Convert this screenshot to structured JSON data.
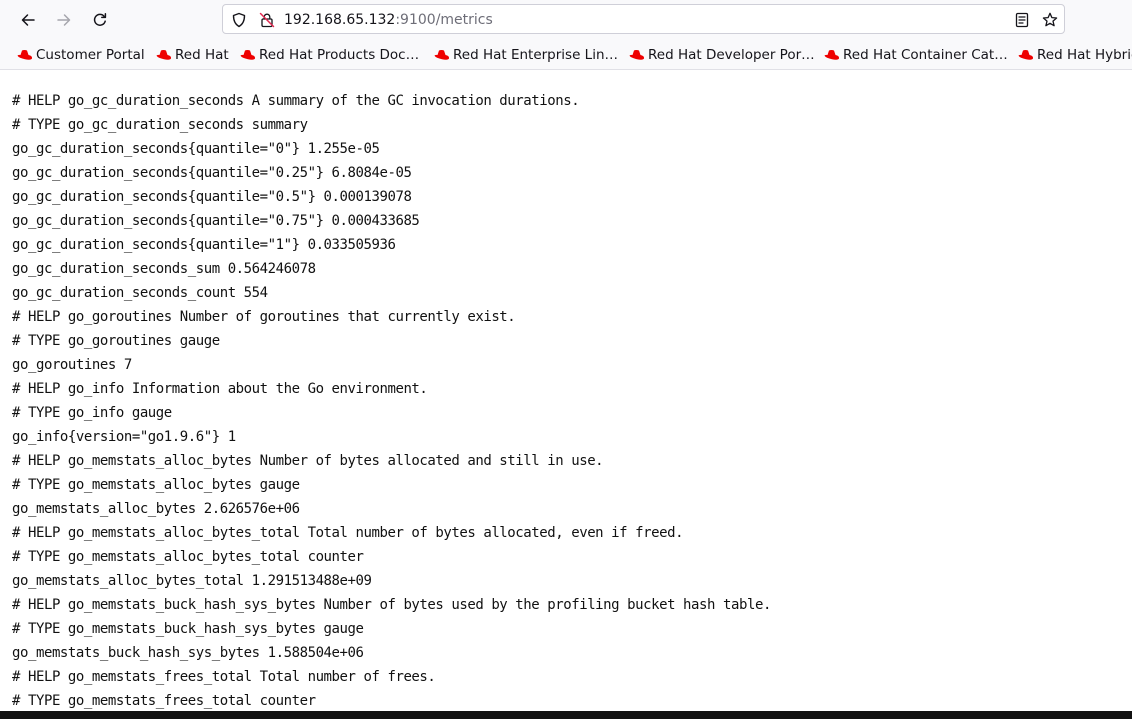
{
  "toolbar": {
    "back_icon": "arrow-left-icon",
    "forward_icon": "arrow-right-icon",
    "reload_icon": "reload-icon",
    "url": {
      "host": "192.168.65.132",
      "rest": ":9100/metrics"
    },
    "icons": [
      "shield-icon",
      "insecure-lock-icon",
      "reader-view-icon",
      "bookmark-star-icon"
    ]
  },
  "bookmarks": [
    {
      "label": "Customer Portal",
      "icon": "red-hat-icon"
    },
    {
      "label": "Red Hat",
      "icon": "red-hat-icon"
    },
    {
      "label": "Red Hat Products Doc…",
      "icon": "red-hat-icon"
    },
    {
      "label": "Red Hat Enterprise Lin…",
      "icon": "red-hat-icon"
    },
    {
      "label": "Red Hat Developer Por…",
      "icon": "red-hat-icon"
    },
    {
      "label": "Red Hat Container Cat…",
      "icon": "red-hat-icon"
    },
    {
      "label": "Red Hat Hybrid",
      "icon": "red-hat-icon"
    }
  ],
  "colors": {
    "red_hat": "#ee0000",
    "toolbar_bg": "#f9f9fb",
    "text": "#111111"
  },
  "metrics": [
    "# HELP go_gc_duration_seconds A summary of the GC invocation durations.",
    "# TYPE go_gc_duration_seconds summary",
    "go_gc_duration_seconds{quantile=\"0\"} 1.255e-05",
    "go_gc_duration_seconds{quantile=\"0.25\"} 6.8084e-05",
    "go_gc_duration_seconds{quantile=\"0.5\"} 0.000139078",
    "go_gc_duration_seconds{quantile=\"0.75\"} 0.000433685",
    "go_gc_duration_seconds{quantile=\"1\"} 0.033505936",
    "go_gc_duration_seconds_sum 0.564246078",
    "go_gc_duration_seconds_count 554",
    "# HELP go_goroutines Number of goroutines that currently exist.",
    "# TYPE go_goroutines gauge",
    "go_goroutines 7",
    "# HELP go_info Information about the Go environment.",
    "# TYPE go_info gauge",
    "go_info{version=\"go1.9.6\"} 1",
    "# HELP go_memstats_alloc_bytes Number of bytes allocated and still in use.",
    "# TYPE go_memstats_alloc_bytes gauge",
    "go_memstats_alloc_bytes 2.626576e+06",
    "# HELP go_memstats_alloc_bytes_total Total number of bytes allocated, even if freed.",
    "# TYPE go_memstats_alloc_bytes_total counter",
    "go_memstats_alloc_bytes_total 1.291513488e+09",
    "# HELP go_memstats_buck_hash_sys_bytes Number of bytes used by the profiling bucket hash table.",
    "# TYPE go_memstats_buck_hash_sys_bytes gauge",
    "go_memstats_buck_hash_sys_bytes 1.588504e+06",
    "# HELP go_memstats_frees_total Total number of frees.",
    "# TYPE go_memstats_frees_total counter"
  ]
}
